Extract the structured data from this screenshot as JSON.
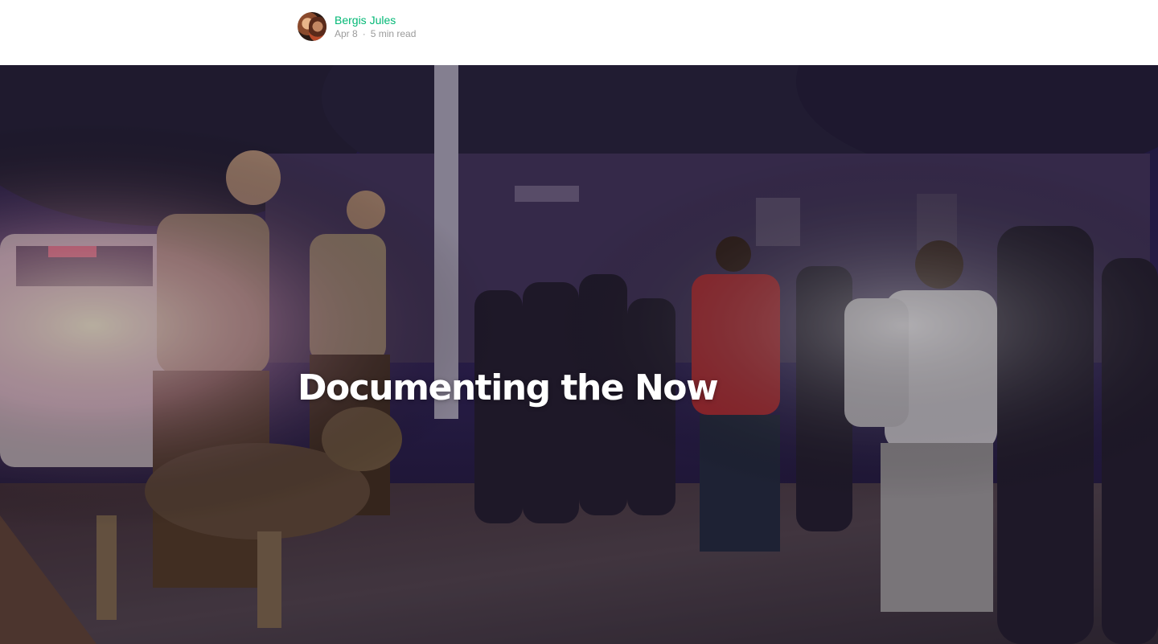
{
  "author": {
    "name": "Bergis Jules",
    "avatar_icon": "author-avatar"
  },
  "post_meta": {
    "date": "Apr 8",
    "separator": "·",
    "read_time": "5 min read"
  },
  "hero": {
    "title": "Documenting the Now",
    "image_description_icon": "hero-photo"
  },
  "colors": {
    "accent": "#02b875",
    "muted": "#9b9b9b"
  }
}
